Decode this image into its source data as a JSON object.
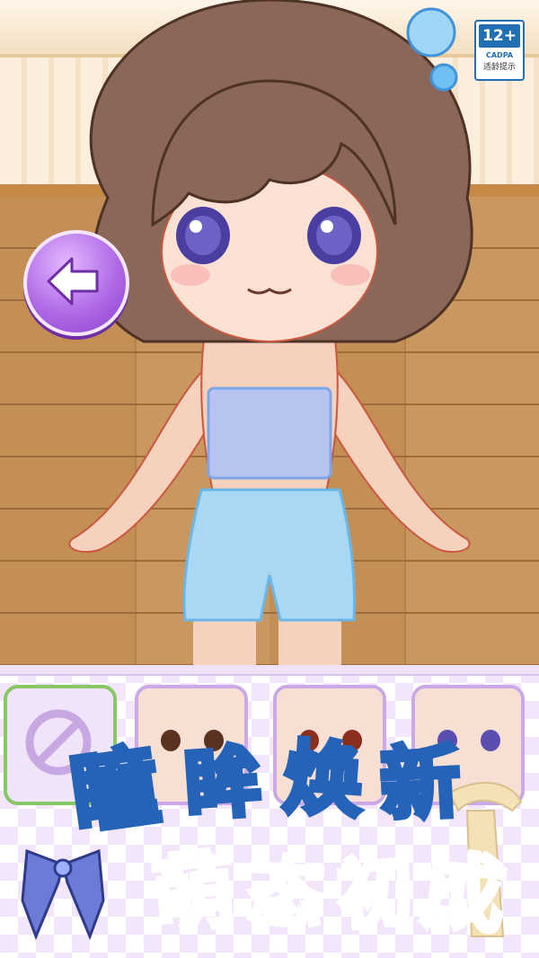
{
  "rating": {
    "age": "12+",
    "org": "CADPA",
    "notice": "适龄提示"
  },
  "back_button": {
    "icon": "arrow-left-icon"
  },
  "banner": {
    "line1": [
      "瞳",
      "眸",
      "焕",
      "新"
    ],
    "line2": [
      "萌",
      "态",
      "初",
      "成"
    ]
  },
  "options": [
    {
      "id": "none",
      "icon": "no-icon"
    },
    {
      "id": "eyes-brown"
    },
    {
      "id": "eyes-red"
    },
    {
      "id": "eyes-purple"
    }
  ],
  "colors": {
    "accent": "#1f6fb2",
    "back_button": "#b06ae6",
    "selected_border": "#88c765",
    "slot_border": "#c9a9e6",
    "title_fill": "#ffffff",
    "title_stroke": "#2463b8",
    "title2_fill": "#ff7a2e"
  }
}
